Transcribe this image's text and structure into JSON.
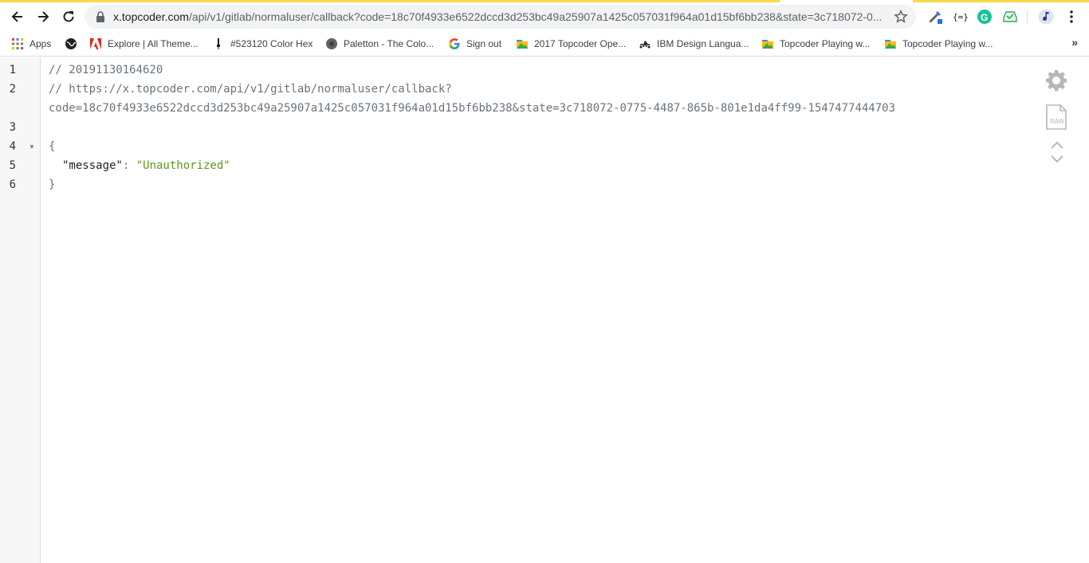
{
  "browser": {
    "url_host": "x.topcoder.com",
    "url_path": "/api/v1/gitlab/normaluser/callback?code=18c70f4933e6522dccd3d253bc49a25907a1425c057031f964a01d15bf6bb238&state=3c718072-0..."
  },
  "bookmarks": [
    {
      "label": "Apps",
      "icon": "apps-grid-icon"
    },
    {
      "label": "",
      "icon": "globe-icon"
    },
    {
      "label": "Explore | All Theme...",
      "icon": "adobe-icon"
    },
    {
      "label": "#523120 Color Hex",
      "icon": "color-dropper-icon"
    },
    {
      "label": "Paletton - The Colo...",
      "icon": "paletton-icon"
    },
    {
      "label": "Sign out",
      "icon": "google-icon"
    },
    {
      "label": "2017 Topcoder Ope...",
      "icon": "topcoder-icon"
    },
    {
      "label": "IBM Design Langua...",
      "icon": "ibm-icon"
    },
    {
      "label": "Topcoder Playing w...",
      "icon": "topcoder-icon"
    },
    {
      "label": "Topcoder Playing w...",
      "icon": "topcoder-icon"
    }
  ],
  "lines": {
    "n1": "1",
    "n2": "2",
    "n3": "3",
    "n4": "4",
    "n5": "5",
    "n6": "6",
    "l1": "// 20191130164620",
    "l2a": "// https://x.topcoder.com/api/v1/gitlab/normaluser/callback?",
    "l2b": "code=18c70f4933e6522dccd3d253bc49a25907a1425c057031f964a01d15bf6bb238&state=3c718072-0775-4487-865b-801e1da4ff99-1547477444703",
    "l4": "{",
    "l5key": "\"message\"",
    "l5colon": ": ",
    "l5val": "\"Unauthorized\"",
    "l6": "}"
  },
  "tools": {
    "raw_label": "RAW"
  },
  "colors": {
    "accent_stripe": "#f7d94c",
    "string": "#5d9a1c",
    "comment": "#6a737d"
  }
}
